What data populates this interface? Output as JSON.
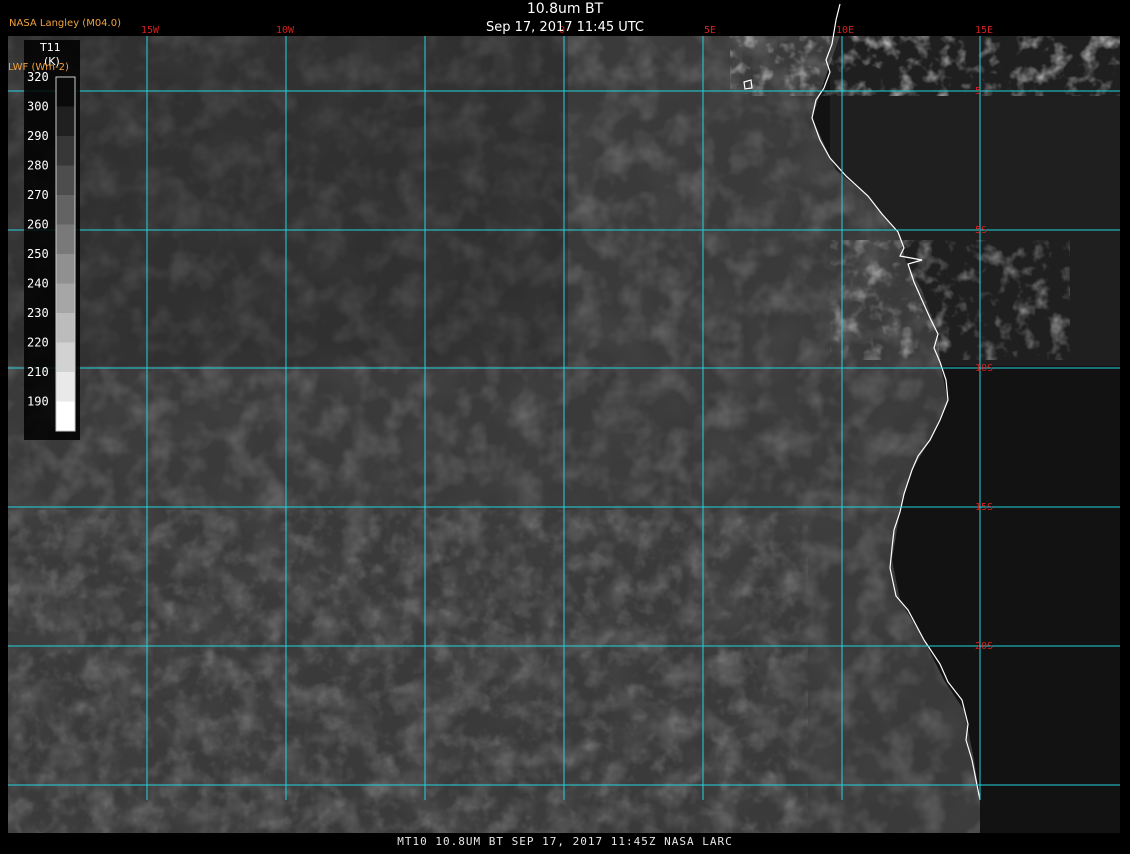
{
  "header": {
    "title": "10.8um BT",
    "timestamp": "Sep 17, 2017 11:45 UTC",
    "credit": "NASA Langley (M04.0)"
  },
  "colorbar": {
    "variable": "T11",
    "unit": "(K)",
    "lwf_label": "LWF (Wm-2)",
    "ticks": [
      "320",
      "300",
      "290",
      "280",
      "270",
      "260",
      "250",
      "240",
      "230",
      "220",
      "210",
      "190"
    ]
  },
  "grid": {
    "lon_labels": [
      "15W",
      "10W",
      "0",
      "5E",
      "10E",
      "15E"
    ],
    "lat_labels": [
      "5",
      "5S",
      "10S",
      "15S",
      "20S"
    ],
    "line_color": "#22d3de",
    "label_color": "#d62020"
  },
  "map": {
    "coastline_color": "#ffffff",
    "ocean_tone": "#3a3a3a",
    "land_tone": "#121212",
    "cloud_tone": "#bdbdbd"
  },
  "footer": {
    "text": "MT10  10.8UM BT   SEP 17, 2017 11:45Z   NASA LARC"
  }
}
